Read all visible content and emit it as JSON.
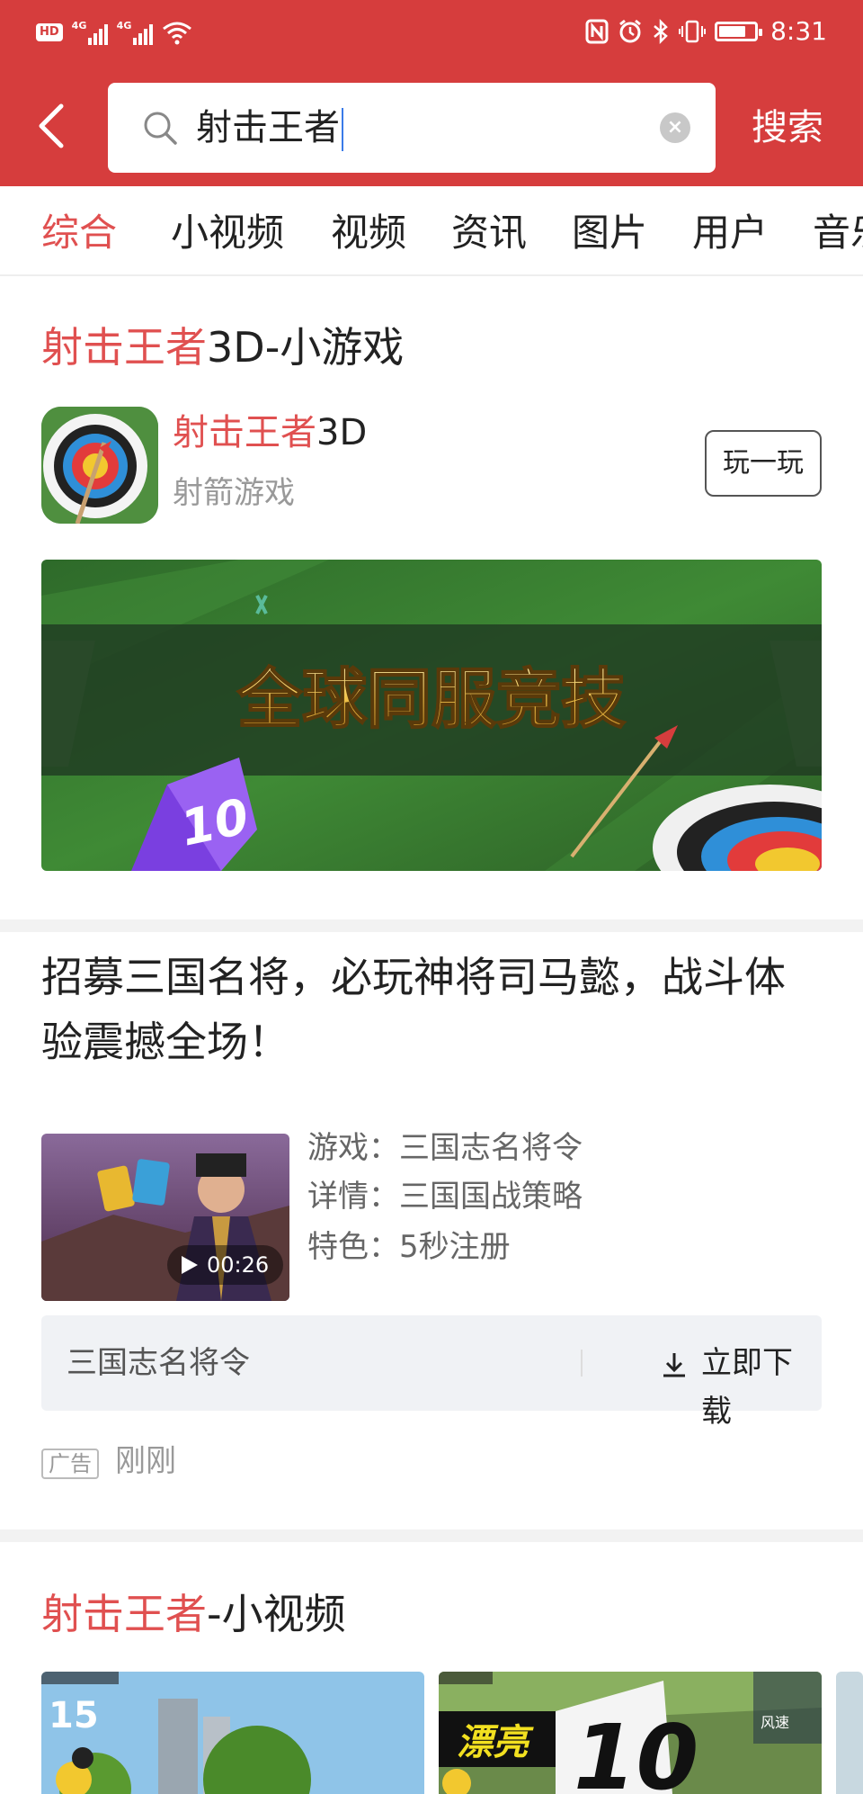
{
  "status_bar": {
    "hd": "HD",
    "network1": "4G",
    "network2": "4G",
    "time": "8:31",
    "battery_level": 0.75
  },
  "header": {
    "search_query": "射击王者",
    "search_button": "搜索"
  },
  "tabs": [
    {
      "label": "综合",
      "active": true
    },
    {
      "label": "小视频"
    },
    {
      "label": "视频"
    },
    {
      "label": "资讯"
    },
    {
      "label": "图片"
    },
    {
      "label": "用户"
    },
    {
      "label": "音乐"
    }
  ],
  "game_card": {
    "title_highlight": "射击王者",
    "title_rest": "3D-小游戏",
    "app_name_highlight": "射击王者",
    "app_name_rest": "3D",
    "app_category": "射箭游戏",
    "play_button": "玩一玩",
    "banner_text": "全球同服竞技",
    "banner_badge": "10"
  },
  "ad_card": {
    "title": "招募三国名将，必玩神将司马懿，战斗体验震撼全场！",
    "video_duration": "00:26",
    "info": [
      "游戏：三国志名将令",
      "详情：三国国战策略",
      "特色：5秒注册"
    ],
    "app_name": "三国志名将令",
    "download_button": "立即下载",
    "ad_label": "广告",
    "time": "刚刚"
  },
  "video_section": {
    "title_highlight": "射击王者",
    "title_rest": "-小视频",
    "thumb1_score": "15",
    "thumb2_label": "漂亮",
    "thumb2_score": "10",
    "thumb2_wind": "风速"
  },
  "colors": {
    "brand_red": "#d63d3d",
    "highlight_red": "#e05050"
  }
}
